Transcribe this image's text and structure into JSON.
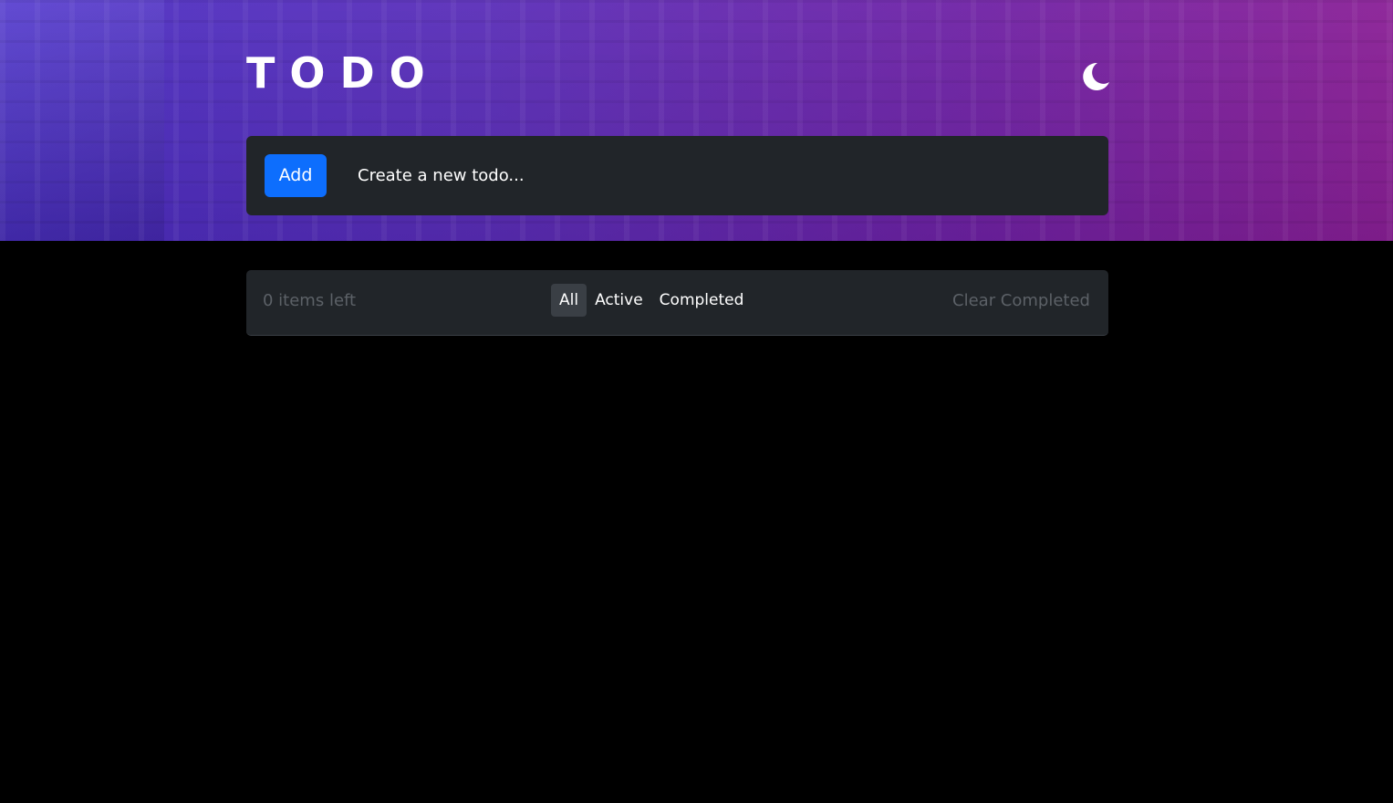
{
  "header": {
    "title": "TODO",
    "theme_toggle_icon": "moon-icon"
  },
  "new_todo": {
    "add_label": "Add",
    "input_value": "",
    "input_placeholder": "Create a new todo..."
  },
  "footer": {
    "items_left": "0 items left",
    "filters": [
      {
        "label": "All",
        "active": true
      },
      {
        "label": "Active",
        "active": false
      },
      {
        "label": "Completed",
        "active": false
      }
    ],
    "clear_label": "Clear Completed"
  },
  "colors": {
    "accent": "#0d6efd",
    "panel": "#212529",
    "background": "#000000",
    "muted_text": "#5c6167",
    "hero_gradient_start": "#4a2fc4",
    "hero_gradient_end": "#8a1f96"
  }
}
